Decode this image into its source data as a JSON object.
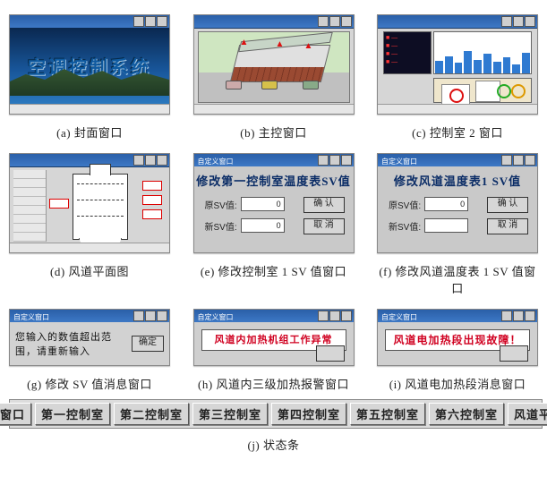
{
  "captions": {
    "a": "(a) 封面窗口",
    "b": "(b) 主控窗口",
    "c": "(c) 控制室 2 窗口",
    "d": "(d) 风道平面图",
    "e": "(e) 修改控制室 1 SV 值窗口",
    "f": "(f) 修改风道温度表 1 SV 值窗口",
    "g": "(g) 修改 SV 值消息窗口",
    "h": "(h) 风道内三级加热报警窗口",
    "i": "(i) 风道电加热段消息窗口",
    "j": "(j) 状态条"
  },
  "a": {
    "title": "空调控制系统"
  },
  "e": {
    "heading": "修改第一控制室温度表SV值",
    "row1_label": "原SV值:",
    "row2_label": "新SV值:",
    "val1": "0",
    "val2": "0",
    "btn_ok": "确  认",
    "btn_cancel": "取  消"
  },
  "f": {
    "heading": "修改风道温度表1 SV值",
    "row1_label": "原SV值:",
    "row2_label": "新SV值:",
    "val1": "0",
    "val2": "",
    "btn_ok": "确  认",
    "btn_cancel": "取  消"
  },
  "g": {
    "title": "自定义窗口",
    "message": "您输入的数值超出范围，请重新输入",
    "ok": "确定"
  },
  "h": {
    "message": "风道内加热机组工作异常"
  },
  "i": {
    "message": "风道电加热段出现故障！"
  },
  "status": {
    "items": [
      "主控窗口",
      "第一控制室",
      "第二控制室",
      "第三控制室",
      "第四控制室",
      "第五控制室",
      "第六控制室",
      "风道平面图"
    ]
  }
}
